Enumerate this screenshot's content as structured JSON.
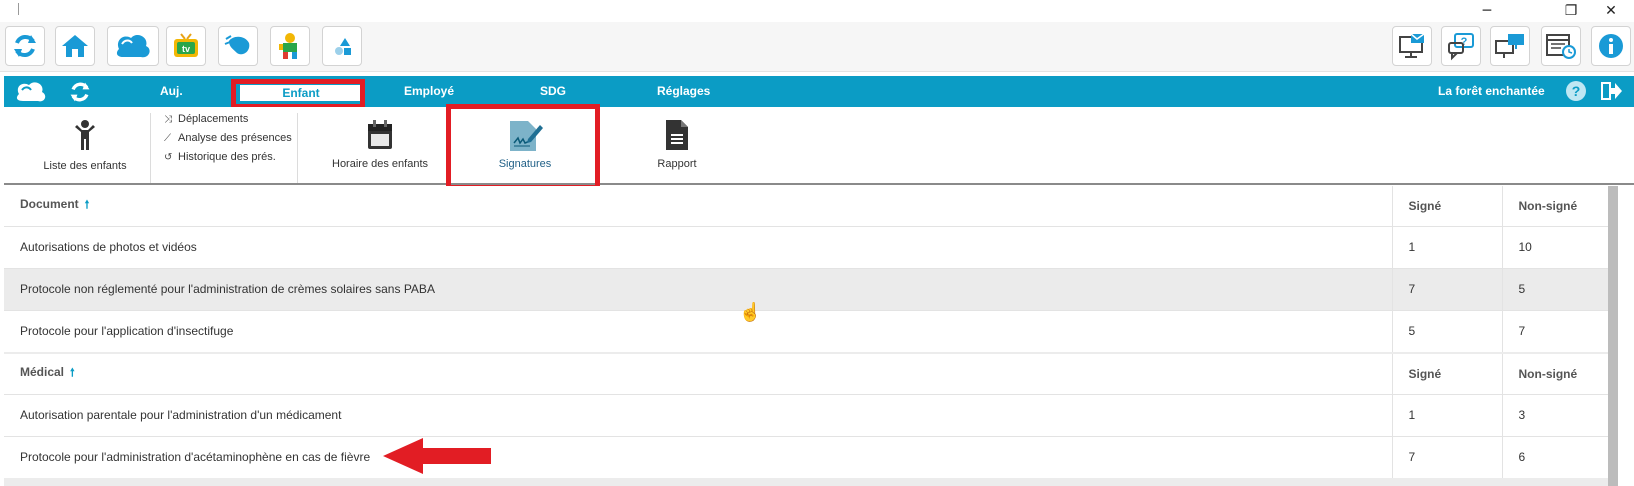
{
  "window": {
    "minimize": "─",
    "restore": "❐",
    "close": "✕"
  },
  "toolbar": {
    "left_icons": [
      "refresh-icon",
      "home-icon",
      "cloud-logo-icon",
      "tv-icon",
      "cloud-wave-icon",
      "kid-toy-icon",
      "shapes-icon"
    ],
    "right_icons": [
      "monitor-mail-icon",
      "help-chat-icon",
      "remote-screens-icon",
      "calendar-clock-icon",
      "info-icon"
    ],
    "accent": "#0b9cc5"
  },
  "nav": {
    "tabs": [
      "Auj.",
      "Enfant",
      "Employé",
      "SDG",
      "Réglages"
    ],
    "active_tab": "Enfant",
    "daycare_name": "La forêt enchantée",
    "help": "?",
    "color": "#0b9cc5"
  },
  "ribbon": {
    "liste_enfants": "Liste des enfants",
    "sublinks": [
      "Déplacements",
      "Analyse des présences",
      "Historique des prés."
    ],
    "horaire": "Horaire des enfants",
    "signatures": "Signatures",
    "rapport": "Rapport"
  },
  "sections": [
    {
      "header": "Document",
      "col_signed": "Signé",
      "col_unsigned": "Non-signé",
      "rows": [
        {
          "name": "Autorisations de photos et vidéos",
          "signed": "1",
          "unsigned": "10"
        },
        {
          "name": "Protocole non réglementé pour l'administration de crèmes solaires sans PABA",
          "signed": "7",
          "unsigned": "5"
        },
        {
          "name": "Protocole pour l'application d'insectifuge",
          "signed": "5",
          "unsigned": "7"
        }
      ]
    },
    {
      "header": "Médical",
      "col_signed": "Signé",
      "col_unsigned": "Non-signé",
      "rows": [
        {
          "name": "Autorisation parentale pour l'administration d'un médicament",
          "signed": "1",
          "unsigned": "3"
        },
        {
          "name": "Protocole pour l'administration d'acétaminophène en cas de fièvre",
          "signed": "7",
          "unsigned": "6"
        }
      ]
    }
  ],
  "annotations": {
    "highlight_color": "#e21d24"
  }
}
